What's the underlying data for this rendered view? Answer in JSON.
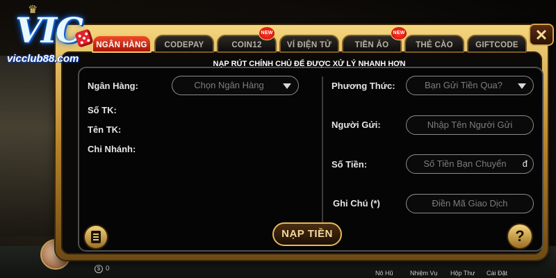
{
  "logo": {
    "brand": "VIC",
    "site": "vicclub88.com"
  },
  "tabs": [
    {
      "label": "NGÂN HÀNG",
      "active": true,
      "badge": ""
    },
    {
      "label": "CODEPAY",
      "active": false,
      "badge": ""
    },
    {
      "label": "COIN12",
      "active": false,
      "badge": "NEW"
    },
    {
      "label": "VÍ ĐIỆN TỬ",
      "active": false,
      "badge": ""
    },
    {
      "label": "TIỀN ẢO",
      "active": false,
      "badge": "NEW"
    },
    {
      "label": "THẺ CÀO",
      "active": false,
      "badge": ""
    },
    {
      "label": "GIFTCODE",
      "active": false,
      "badge": ""
    }
  ],
  "close_label": "✕",
  "notice": "NẠP RÚT CHÍNH CHỦ ĐỂ ĐƯỢC XỬ LÝ NHANH HƠN",
  "left_form": {
    "bank_label": "Ngân Hàng:",
    "bank_select": "Chọn Ngân Hàng",
    "account_no_label": "Số TK:",
    "account_name_label": "Tên TK:",
    "branch_label": "Chi Nhánh:"
  },
  "right_form": {
    "method_label": "Phương Thức:",
    "method_select": "Bạn Gửi Tiền Qua?",
    "sender_label": "Người Gửi:",
    "sender_placeholder": "Nhập Tên Người Gửi",
    "amount_label": "Số Tiền:",
    "amount_placeholder": "Số Tiền Bạn Chuyển",
    "amount_unit": "đ",
    "note_label": "Ghi Chú (*)",
    "note_placeholder": "Điền Mã Giao Dịch"
  },
  "submit_label": "NẠP TIỀN",
  "help_label": "?",
  "bottom": {
    "coin_value": "0",
    "nav": [
      "Nô Hũ",
      "Nhiệm Vụ",
      "Hộp Thư",
      "Cài Đặt"
    ]
  },
  "colors": {
    "accent_gold": "#e7b95b",
    "active_tab": "#d82a14",
    "panel_bg": "#050505"
  }
}
